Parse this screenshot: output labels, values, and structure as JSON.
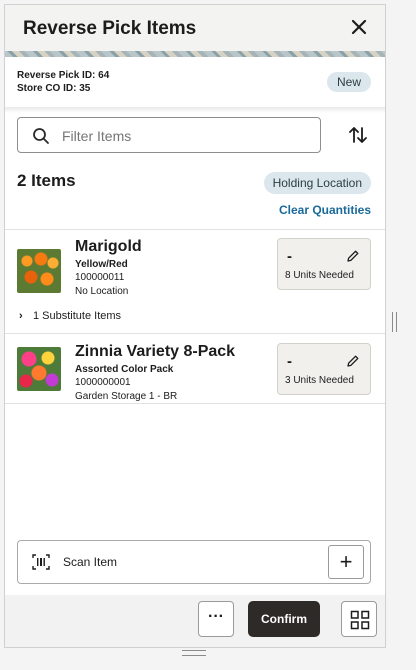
{
  "header": {
    "title": "Reverse Pick Items",
    "close_icon": "close-icon"
  },
  "summary": {
    "reverse_pick_id": "Reverse Pick ID: 64",
    "store_co_id": "Store CO ID: 35",
    "status": "New"
  },
  "filter": {
    "placeholder": "Filter Items",
    "search_icon": "search-icon",
    "sort_icon": "sort-icon"
  },
  "list": {
    "count_label": "2 Items",
    "holding_location_label": "Holding Location",
    "clear_quantities_label": "Clear Quantities",
    "items": [
      {
        "name": "Marigold",
        "variant": "Yellow/Red",
        "code": "100000011",
        "location": "No Location",
        "qty_value": "-",
        "qty_needed": "8 Units Needed",
        "substitutes": "1 Substitute Items"
      },
      {
        "name": "Zinnia Variety 8-Pack",
        "variant": "Assorted Color Pack",
        "code": "1000000001",
        "location": "Garden Storage 1 - BR",
        "qty_value": "-",
        "qty_needed": "3 Units Needed"
      }
    ]
  },
  "scan": {
    "label": "Scan Item",
    "add_label": "+"
  },
  "footer": {
    "more_label": "···",
    "confirm_label": "Confirm"
  },
  "colors": {
    "accent_dark": "#2d2a27",
    "chip_bg": "#dbe7ec",
    "link": "#1a6a9a"
  }
}
